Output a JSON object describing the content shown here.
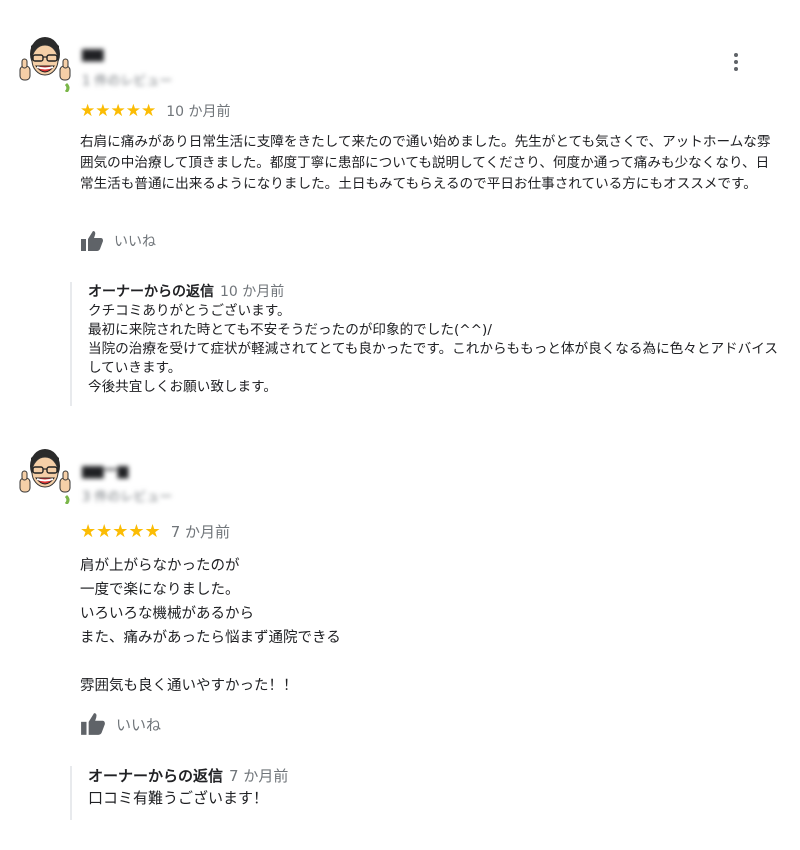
{
  "icons": {
    "more": "more-vert-icon",
    "like": "thumbs-up-icon",
    "avatar": "cartoon-man-thumbs-up-avatar"
  },
  "colors": {
    "star": "#fbbc04",
    "secondary_text": "#70757a",
    "text": "#202124"
  },
  "reviews": [
    {
      "author": "▆▆",
      "subline": "1 件のレビュー",
      "stars": "★★★★★",
      "rating": 5,
      "time": "10 か月前",
      "text": "右肩に痛みがあり日常生活に支障をきたして来たので通い始めました。先生がとても気さくで、アットホームな雰囲気の中治療して頂きました。都度丁寧に患部についても説明してくださり、何度か通って痛みも少なくなり、日常生活も普通に出来るようになりました。土日もみてもらえるので平日お仕事されている方にもオススメです。",
      "like_label": "いいね",
      "owner_reply": {
        "label": "オーナーからの返信",
        "time": "10 か月前",
        "text": "クチコミありがとうございます。\n最初に来院された時とても不安そうだったのが印象的でした(^^)/\n当院の治療を受けて症状が軽減されてとても良かったです。これからももっと体が良くなる為に色々とアドバイスしていきます。\n今後共宜しくお願い致します。"
      }
    },
    {
      "author": "▆▆ー▆",
      "subline": "3 件のレビュー",
      "stars": "★★★★★",
      "rating": 5,
      "time": "7 か月前",
      "text": "肩が上がらなかったのが\n一度で楽になりました。\nいろいろな機械があるから\nまた、痛みがあったら悩まず通院できる\n\n雰囲気も良く通いやすかった！！",
      "like_label": "いいね",
      "owner_reply": {
        "label": "オーナーからの返信",
        "time": "7 か月前",
        "text": "口コミ有難うございます！"
      }
    }
  ]
}
